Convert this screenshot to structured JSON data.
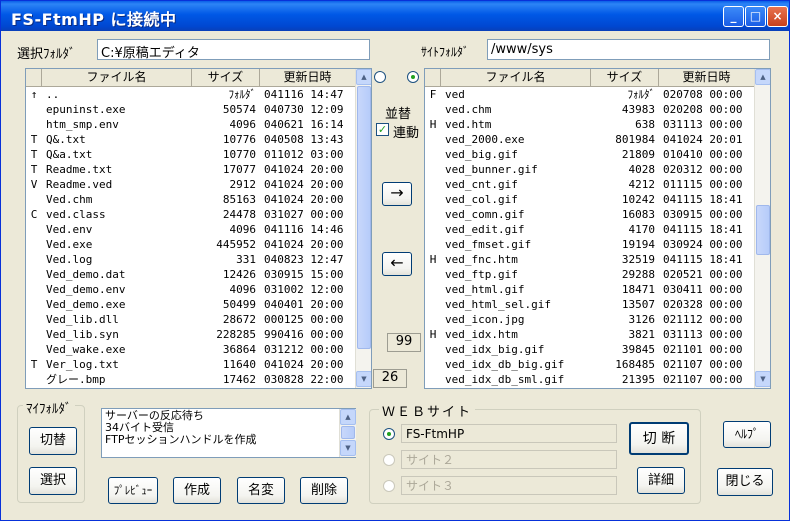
{
  "window": {
    "title": "FS-FtmHP に接続中",
    "min": "_",
    "max": "□",
    "close": "×"
  },
  "left": {
    "label": "選択ﾌｫﾙﾀﾞ",
    "path": "C:¥原稿エディタ",
    "columns": [
      "",
      "ファイル名",
      "サイズ",
      "更新日時"
    ],
    "rows": [
      [
        "↑",
        "..",
        "ﾌｫﾙﾀﾞ",
        "041116 14:47"
      ],
      [
        "",
        "epuninst.exe",
        "50574",
        "040730 12:09"
      ],
      [
        "",
        "htm_smp.env",
        "4096",
        "040621 16:14"
      ],
      [
        "T",
        "Q&.txt",
        "10776",
        "040508 13:43"
      ],
      [
        "T",
        "Q&a.txt",
        "10770",
        "011012 03:00"
      ],
      [
        "T",
        "Readme.txt",
        "17077",
        "041024 20:00"
      ],
      [
        "V",
        "Readme.ved",
        "2912",
        "041024 20:00"
      ],
      [
        "",
        "Ved.chm",
        "85163",
        "041024 20:00"
      ],
      [
        "C",
        "ved.class",
        "24478",
        "031027 00:00"
      ],
      [
        "",
        "Ved.env",
        "4096",
        "041116 14:46"
      ],
      [
        "",
        "Ved.exe",
        "445952",
        "041024 20:00"
      ],
      [
        "",
        "Ved.log",
        "331",
        "040823 12:47"
      ],
      [
        "",
        "Ved_demo.dat",
        "12426",
        "030915 15:00"
      ],
      [
        "",
        "Ved_demo.env",
        "4096",
        "031002 12:00"
      ],
      [
        "",
        "Ved_demo.exe",
        "50499",
        "040401 20:00"
      ],
      [
        "",
        "Ved_lib.dll",
        "28672",
        "000125 00:00"
      ],
      [
        "",
        "Ved_lib.syn",
        "228285",
        "990416 00:00"
      ],
      [
        "",
        "Ved_wake.exe",
        "36864",
        "031212 00:00"
      ],
      [
        "T",
        "Ver_log.txt",
        "11640",
        "041024 20:00"
      ],
      [
        "",
        "グレー.bmp",
        "17462",
        "030828 22:00"
      ]
    ]
  },
  "right": {
    "label": "ｻｲﾄﾌｫﾙﾀﾞ",
    "path": "/www/sys",
    "columns": [
      "",
      "ファイル名",
      "サイズ",
      "更新日時"
    ],
    "rows": [
      [
        "F",
        "ved",
        "ﾌｫﾙﾀﾞ",
        "020708 00:00"
      ],
      [
        "",
        "ved.chm",
        "43983",
        "020208 00:00"
      ],
      [
        "H",
        "ved.htm",
        "638",
        "031113 00:00"
      ],
      [
        "",
        "ved_2000.exe",
        "801984",
        "041024 20:01"
      ],
      [
        "",
        "ved_big.gif",
        "21809",
        "010410 00:00"
      ],
      [
        "",
        "ved_bunner.gif",
        "4028",
        "020312 00:00"
      ],
      [
        "",
        "ved_cnt.gif",
        "4212",
        "011115 00:00"
      ],
      [
        "",
        "ved_col.gif",
        "10242",
        "041115 18:41"
      ],
      [
        "",
        "ved_comn.gif",
        "16083",
        "030915 00:00"
      ],
      [
        "",
        "ved_edit.gif",
        "4170",
        "041115 18:41"
      ],
      [
        "",
        "ved_fmset.gif",
        "19194",
        "030924 00:00"
      ],
      [
        "H",
        "ved_fnc.htm",
        "32519",
        "041115 18:41"
      ],
      [
        "",
        "ved_ftp.gif",
        "29288",
        "020521 00:00"
      ],
      [
        "",
        "ved_html.gif",
        "18471",
        "030411 00:00"
      ],
      [
        "",
        "ved_html_sel.gif",
        "13507",
        "020328 00:00"
      ],
      [
        "",
        "ved_icon.jpg",
        "3126",
        "021112 00:00"
      ],
      [
        "H",
        "ved_idx.htm",
        "3821",
        "031113 00:00"
      ],
      [
        "",
        "ved_idx_big.gif",
        "39845",
        "021101 00:00"
      ],
      [
        "",
        "ved_idx_db_big.gif",
        "168485",
        "021107 00:00"
      ],
      [
        "",
        "ved_idx_db_sml.gif",
        "21395",
        "021107 00:00"
      ]
    ]
  },
  "middle": {
    "sort_label": "並替",
    "link_label": "連動",
    "link_checked": true,
    "left_count": "26",
    "right_count": "99",
    "upload_arrow": "→",
    "download_arrow": "←"
  },
  "myfolder": {
    "title": "ﾏｲﾌｫﾙﾀﾞ",
    "switch": "切替",
    "select": "選択"
  },
  "log": {
    "lines": [
      "サーバーの反応待ち",
      "34バイト受信",
      "FTPセッションハンドルを作成"
    ]
  },
  "buttons": {
    "preview": "ﾌﾟﾚﾋﾞｭｰ",
    "create": "作成",
    "rename": "名変",
    "delete": "削除",
    "disconnect": "切 断",
    "detail": "詳細",
    "help": "ﾍﾙﾌﾟ",
    "close": "閉じる"
  },
  "web": {
    "title": "ＷＥＢサイト",
    "sites": [
      "FS-FtmHP",
      "サイト２",
      "サイト３"
    ]
  }
}
